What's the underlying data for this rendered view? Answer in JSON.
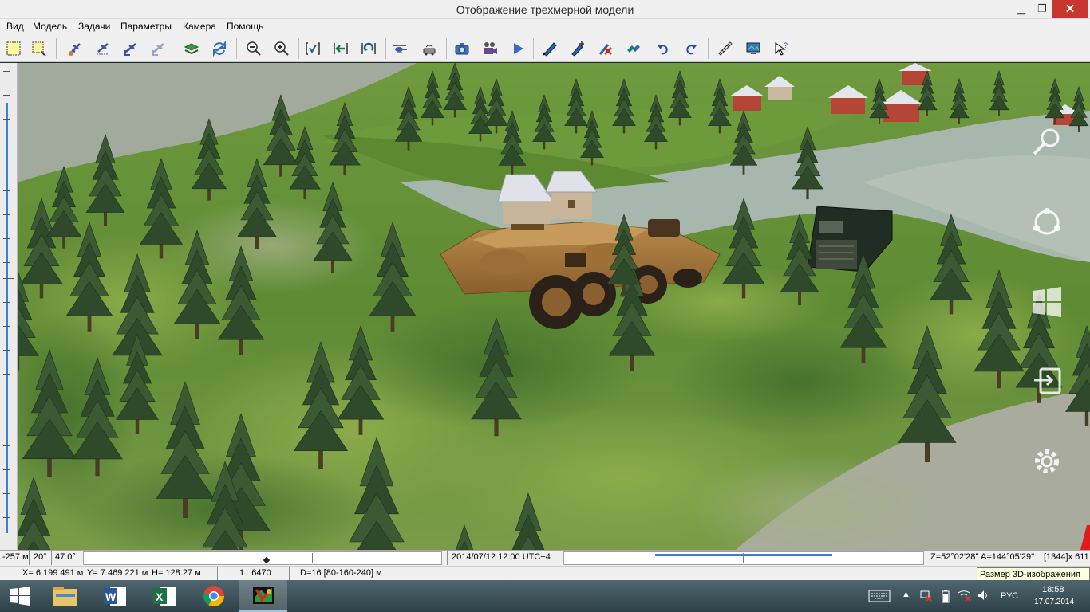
{
  "window": {
    "title": "Отображение трехмерной модели",
    "minimize_glyph": "▁",
    "maximize_glyph": "❐",
    "close_glyph": "✕"
  },
  "menu": [
    "Вид",
    "Модель",
    "Задачи",
    "Параметры",
    "Камера",
    "Помощь"
  ],
  "toolbar_icons": [
    "select-rect-icon",
    "select-move-icon",
    "plane-gear-icon",
    "plane-grid-icon",
    "plane-down-icon",
    "plane-disabled-icon",
    "layers-icon",
    "refresh-icon",
    "zoom-out-icon",
    "zoom-in-icon",
    "check-bracket-icon",
    "arrow-left-icon",
    "rotate-icon",
    "helicopter-icon",
    "vehicle-radar-icon",
    "camera-icon",
    "video-camera-icon",
    "play-icon",
    "pen-icon",
    "pen-plus-icon",
    "delete-route-icon",
    "swap-icon",
    "undo-icon",
    "redo-icon",
    "ruler-icon",
    "screenshot-icon",
    "help-pointer-icon"
  ],
  "status": {
    "altitude_left": "-257 м",
    "pitch": "20°",
    "fov": "47.0°",
    "datetime": "2014/07/12  12:00  UTC+4",
    "coords_angle": "Z=52°02'28''  A=144°05'29''",
    "view_size": "[1344]x 611",
    "x": "X= 6 199 491 м",
    "y": "Y= 7 469 221 м",
    "h": "H= 128.27 м",
    "scale": "1 : 6470",
    "distance": "D=16 [80-160-240] м"
  },
  "tooltip": "Размер 3D-изображения",
  "taskbar": {
    "start_icon": "windows-start-icon",
    "apps": [
      "file-explorer-icon",
      "word-icon",
      "excel-icon",
      "chrome-icon",
      "3d-model-app-icon"
    ],
    "language": "РУС",
    "time": "18:58",
    "date": "17.07.2014"
  },
  "colors": {
    "grass": "#6a8a3e",
    "water": "#a7b6ad",
    "vehicle_btr": "#a3783f",
    "truck": "#1f2d25",
    "house_roof": "#d9dde3",
    "house_red": "#b44537",
    "accent_blue": "#3d7fd6"
  }
}
